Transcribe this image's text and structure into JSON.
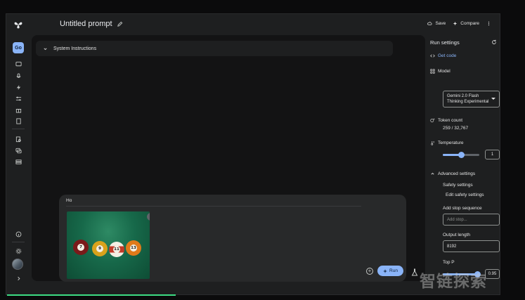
{
  "header": {
    "title": "Untitled prompt",
    "save_label": "Save",
    "compare_label": "Compare"
  },
  "rail": {
    "active_label": "Go"
  },
  "main": {
    "system_instructions_label": "System Instructions"
  },
  "composer": {
    "input_text": "Ho",
    "image_alt": "Billiard balls on green table",
    "balls": [
      "7",
      "9",
      "11",
      "13"
    ],
    "run_label": "Run"
  },
  "run_settings": {
    "title": "Run settings",
    "get_code_label": "Get code",
    "model_label": "Model",
    "model_value": "Gemini 2.0 Flash Thinking Experimental",
    "token_count_label": "Token count",
    "token_count_value": "259 / 32,767",
    "temperature_label": "Temperature",
    "temperature_value": "1",
    "temperature_fraction": 0.5,
    "advanced_settings_label": "Advanced settings",
    "safety_settings_label": "Safety settings",
    "edit_safety_label": "Edit safety settings",
    "stop_sequence_label": "Add stop sequence",
    "stop_sequence_placeholder": "Add stop...",
    "output_length_label": "Output length",
    "output_length_value": "8192",
    "top_p_label": "Top P",
    "top_p_value": "0.95",
    "top_p_fraction": 0.95
  },
  "watermark": "智链探索",
  "colors": {
    "accent": "#8ab4f8",
    "panel_bg": "#1e1f20",
    "canvas_bg": "#131314"
  }
}
